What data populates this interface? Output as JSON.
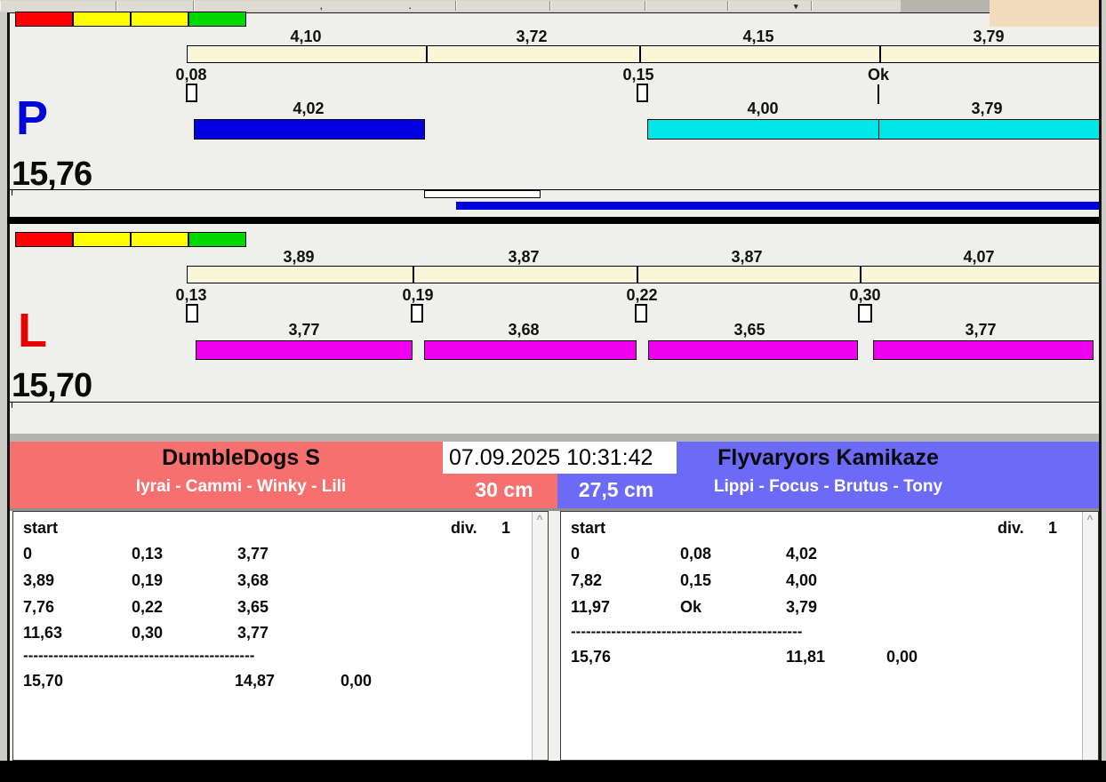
{
  "clock": {
    "datetime": "07.09.2025 10:31:42"
  },
  "lanes": {
    "p": {
      "letter": "P",
      "total": "15,76",
      "splits": [
        "4,10",
        "3,72",
        "4,15",
        "3,79"
      ],
      "markers": [
        "0,08",
        "0,15",
        "Ok"
      ],
      "runs": [
        "4,02",
        "4,00",
        "3,79"
      ]
    },
    "l": {
      "letter": "L",
      "total": "15,70",
      "splits": [
        "3,89",
        "3,87",
        "3,87",
        "4,07"
      ],
      "markers": [
        "0,13",
        "0,19",
        "0,22",
        "0,30"
      ],
      "runs": [
        "3,77",
        "3,68",
        "3,65",
        "3,77"
      ]
    }
  },
  "teams": {
    "left": {
      "name": "DumbleDogs S",
      "dogs": "Iyrai - Cammi - Winky - Lili",
      "jump_height": "30 cm",
      "table": {
        "header": "start",
        "div_label": "div.",
        "div_value": "1",
        "rows": [
          [
            "0",
            "0,13",
            "3,77"
          ],
          [
            "3,89",
            "0,19",
            "3,68"
          ],
          [
            "7,76",
            "0,22",
            "3,65"
          ],
          [
            "11,63",
            "0,30",
            "3,77"
          ]
        ],
        "separator": "----------------------------------------------",
        "total_time": "15,70",
        "clean_time": "14,87",
        "penalty": "0,00"
      }
    },
    "right": {
      "name": "Flyvaryors Kamikaze",
      "dogs": "Lippi - Focus - Brutus - Tony",
      "jump_height": "27,5 cm",
      "table": {
        "header": "start",
        "div_label": "div.",
        "div_value": "1",
        "rows": [
          [
            "0",
            "0,08",
            "4,02"
          ],
          [
            "7,82",
            "0,15",
            "4,00"
          ],
          [
            "11,97",
            "Ok",
            "3,79"
          ]
        ],
        "separator": "----------------------------------------------",
        "total_time": "15,76",
        "clean_time": "11,81",
        "penalty": "0,00"
      }
    }
  },
  "colors": {
    "lane_p_bar": "#0000e0",
    "lane_p_bar2": "#00e7e7",
    "lane_l_bar": "#ee00ee",
    "ruler_bg": "#faf7d8",
    "team_left_bg": "#f77070",
    "team_right_bg": "#6b6bf7",
    "light_red": "#ff0000",
    "light_yellow": "#ffff00",
    "light_green": "#00d900"
  },
  "icons": {
    "scroll_up": "^",
    "dropdown": "▾"
  }
}
